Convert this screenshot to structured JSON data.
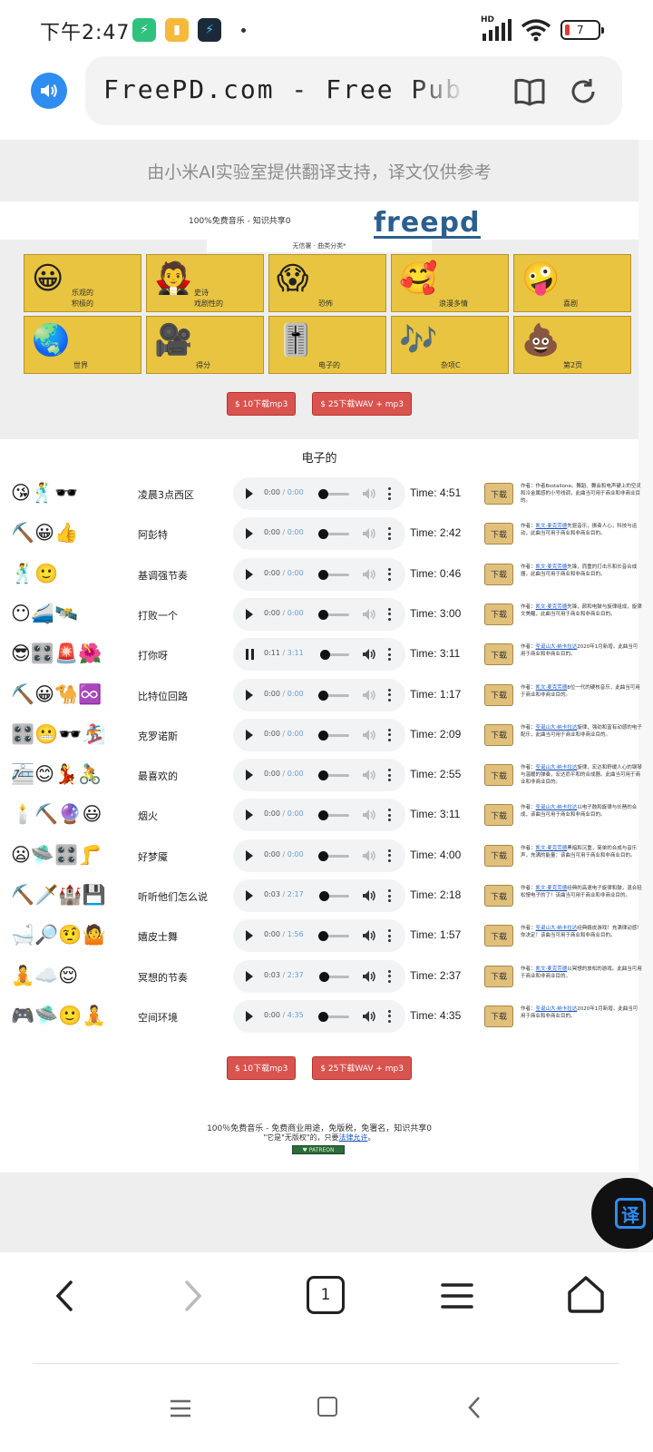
{
  "status_bar": {
    "time": "下午2:47",
    "network": "HD",
    "battery": "7",
    "app_icons": [
      {
        "name": "green-app",
        "color": "#2ec27e",
        "glyph": "⚡"
      },
      {
        "name": "notes-app",
        "color": "#f6b93b",
        "glyph": "▮"
      },
      {
        "name": "game-app",
        "color": "#1b2a3a",
        "glyph": "⚡"
      }
    ]
  },
  "browser": {
    "url": "FreePD.com - Free Public Domain Music",
    "tab_count": "1"
  },
  "translation_banner": "由小米AI实验室提供翻译支持，译文仅供参考",
  "site": {
    "tagline": "100%免费音乐 - 知识共享0",
    "logo": "freepd",
    "nav": "无信署 · 曲类分类*"
  },
  "genres": [
    {
      "emoji": "😀",
      "label": "乐观的\n积极的"
    },
    {
      "emoji": "🧛",
      "label": "史诗\n戏剧性的"
    },
    {
      "emoji": "😱",
      "label": "恐怖"
    },
    {
      "emoji": "🥰",
      "label": "浪漫多情"
    },
    {
      "emoji": "🤪",
      "label": "喜剧"
    },
    {
      "emoji": "🌏",
      "label": "世界"
    },
    {
      "emoji": "🎥",
      "label": "得分"
    },
    {
      "emoji": "🎚️",
      "label": "电子的"
    },
    {
      "emoji": "🎶",
      "label": "杂项C"
    },
    {
      "emoji": "💩",
      "label": "第2页"
    }
  ],
  "download_buttons": {
    "mp3": "$ 10下载mp3",
    "wav": "$ 25下载WAV + mp3"
  },
  "section_title": "电子的",
  "tracks": [
    {
      "emojis": "😘🕺🕶️",
      "title": "凌晨3点西区",
      "current": "0:00",
      "duration": "0:00",
      "progress": 0,
      "time": "Time: 4:51",
      "author": "",
      "desc": "作者Bsstallone。舞蹈、舞会和电声硬上的空灵和冷金属感的小号线调，此曲当可用于商业和非商业目的。",
      "playing": false,
      "muted": true
    },
    {
      "emojis": "⛏️😀👍",
      "title": "阿彭特",
      "current": "0:00",
      "duration": "0:00",
      "progress": 0,
      "time": "Time: 2:42",
      "author": "凯文·麦克劳德",
      "desc": "先驱音乐，振奋人心，科技与运动，此曲当可用于商业和非商业目的。",
      "playing": false,
      "muted": true
    },
    {
      "emojis": "🕺🙂",
      "title": "基调强节奏",
      "current": "0:00",
      "duration": "0:00",
      "progress": 0,
      "time": "Time: 0:46",
      "author": "凯文·麦克劳德",
      "desc": "先锋，而重的打击乐和长音合成器，此曲当可用于商业和非商业目的。",
      "playing": false,
      "muted": true
    },
    {
      "emojis": "😶🚄🛰️",
      "title": "打败一个",
      "current": "0:00",
      "duration": "0:00",
      "progress": 0,
      "time": "Time: 3:00",
      "author": "凯文·麦克劳德",
      "desc": "先锋，颜和电鼓与旋律组成，旋律文美醒，此曲当可用于商业和非商业目的。",
      "playing": false,
      "muted": true
    },
    {
      "emojis": "😎🎛️🚨🌺",
      "title": "打你呀",
      "current": "0:11",
      "duration": "3:11",
      "progress": 0.06,
      "time": "Time: 3:11",
      "author": "圣诞山大·纳卡拉达",
      "desc": "2020年1月新增。此曲当可用于商业和非商业目的。",
      "playing": true,
      "muted": false
    },
    {
      "emojis": "⛏️😀🐪♾️",
      "title": "比特位回路",
      "current": "0:00",
      "duration": "0:00",
      "progress": 0,
      "time": "Time: 1:17",
      "author": "凯文·麦克劳德",
      "desc": "8位一代的硬核音乐，此曲当可用于商业和非商业目的。",
      "playing": false,
      "muted": true
    },
    {
      "emojis": "🎛️😬🕶️🏂",
      "title": "克罗诺斯",
      "current": "0:00",
      "duration": "0:00",
      "progress": 0,
      "time": "Time: 2:09",
      "author": "圣诞山大·纳卡拉达",
      "desc": "旋律，强劲和富有动感的电子配乐，此曲当可用于商业和非商业目的。",
      "playing": false,
      "muted": true
    },
    {
      "emojis": "🚈😊💃🚴",
      "title": "最喜欢的",
      "current": "0:00",
      "duration": "0:00",
      "progress": 0,
      "time": "Time: 2:55",
      "author": "圣诞山大·纳卡拉达",
      "desc": "旋律，宏达和舒缓人心的钢琴与温暖的弹奏，宏达而平和的合成器。此曲当可用于商业和非商业目的。",
      "playing": false,
      "muted": true
    },
    {
      "emojis": "🕯️⛏️🔮😃",
      "title": "烟火",
      "current": "0:00",
      "duration": "0:00",
      "progress": 0,
      "time": "Time: 3:11",
      "author": "圣诞山大·纳卡拉达",
      "desc": "以电子鼓和旋律与长琶的合成，该曲当可用于商业和非商业目的。",
      "playing": false,
      "muted": true
    },
    {
      "emojis": "😦🛸🎛️🦵",
      "title": "好梦魇",
      "current": "0:00",
      "duration": "0:00",
      "progress": 0,
      "time": "Time: 4:00",
      "author": "凯文·麦克劳德",
      "desc": "黑暗和沉重，简单的合成与音乐声，充满的能量：该曲当可用于商业和非商业目的。",
      "playing": false,
      "muted": true
    },
    {
      "emojis": "⛏️🗡️🏰💾",
      "title": "听听他们怎么说",
      "current": "0:03",
      "duration": "2:17",
      "progress": 0.02,
      "time": "Time: 2:18",
      "author": "凯文·麦克劳德",
      "desc": "经典的高速电子旋律和鼓，混合轻松慢电子的了！该曲当可用于商业和非商业目的。",
      "playing": false,
      "muted": false
    },
    {
      "emojis": "🛁🔎🤨🤷",
      "title": "嬉皮士舞",
      "current": "0:00",
      "duration": "1:56",
      "progress": 0,
      "time": "Time: 1:57",
      "author": "圣诞山大·纳卡拉达",
      "desc": "经典嬉皮游戏！充满律动感！你决定！该曲当可用于商业和非商业目的。",
      "playing": false,
      "muted": false
    },
    {
      "emojis": "🧘☁️😌",
      "title": "冥想的节奏",
      "current": "0:03",
      "duration": "2:37",
      "progress": 0.02,
      "time": "Time: 2:37",
      "author": "凯文·麦克劳德",
      "desc": "以冥想的放松的游戏。此曲当可用于商业和非商业目的。",
      "playing": false,
      "muted": false
    },
    {
      "emojis": "🎮🛸🙂🧘",
      "title": "空间环境",
      "current": "0:00",
      "duration": "4:35",
      "progress": 0,
      "time": "Time: 4:35",
      "author": "圣诞山大·纳卡拉达",
      "desc": "2020年1月新增。此曲当可用于商业和非商业目的。",
      "playing": false,
      "muted": false
    }
  ],
  "download_label": "下载",
  "author_prefix": "作者：",
  "footer": {
    "line1": "100％免费音乐 - 免费商业用途，免版税，免署名，知识共享0",
    "line2_prefix": "\"它是\"无版权\"的，只要",
    "line2_link": "法律允许",
    "line2_suffix": "。",
    "patreon": "♥ PATREON"
  },
  "translate_fab": "译"
}
